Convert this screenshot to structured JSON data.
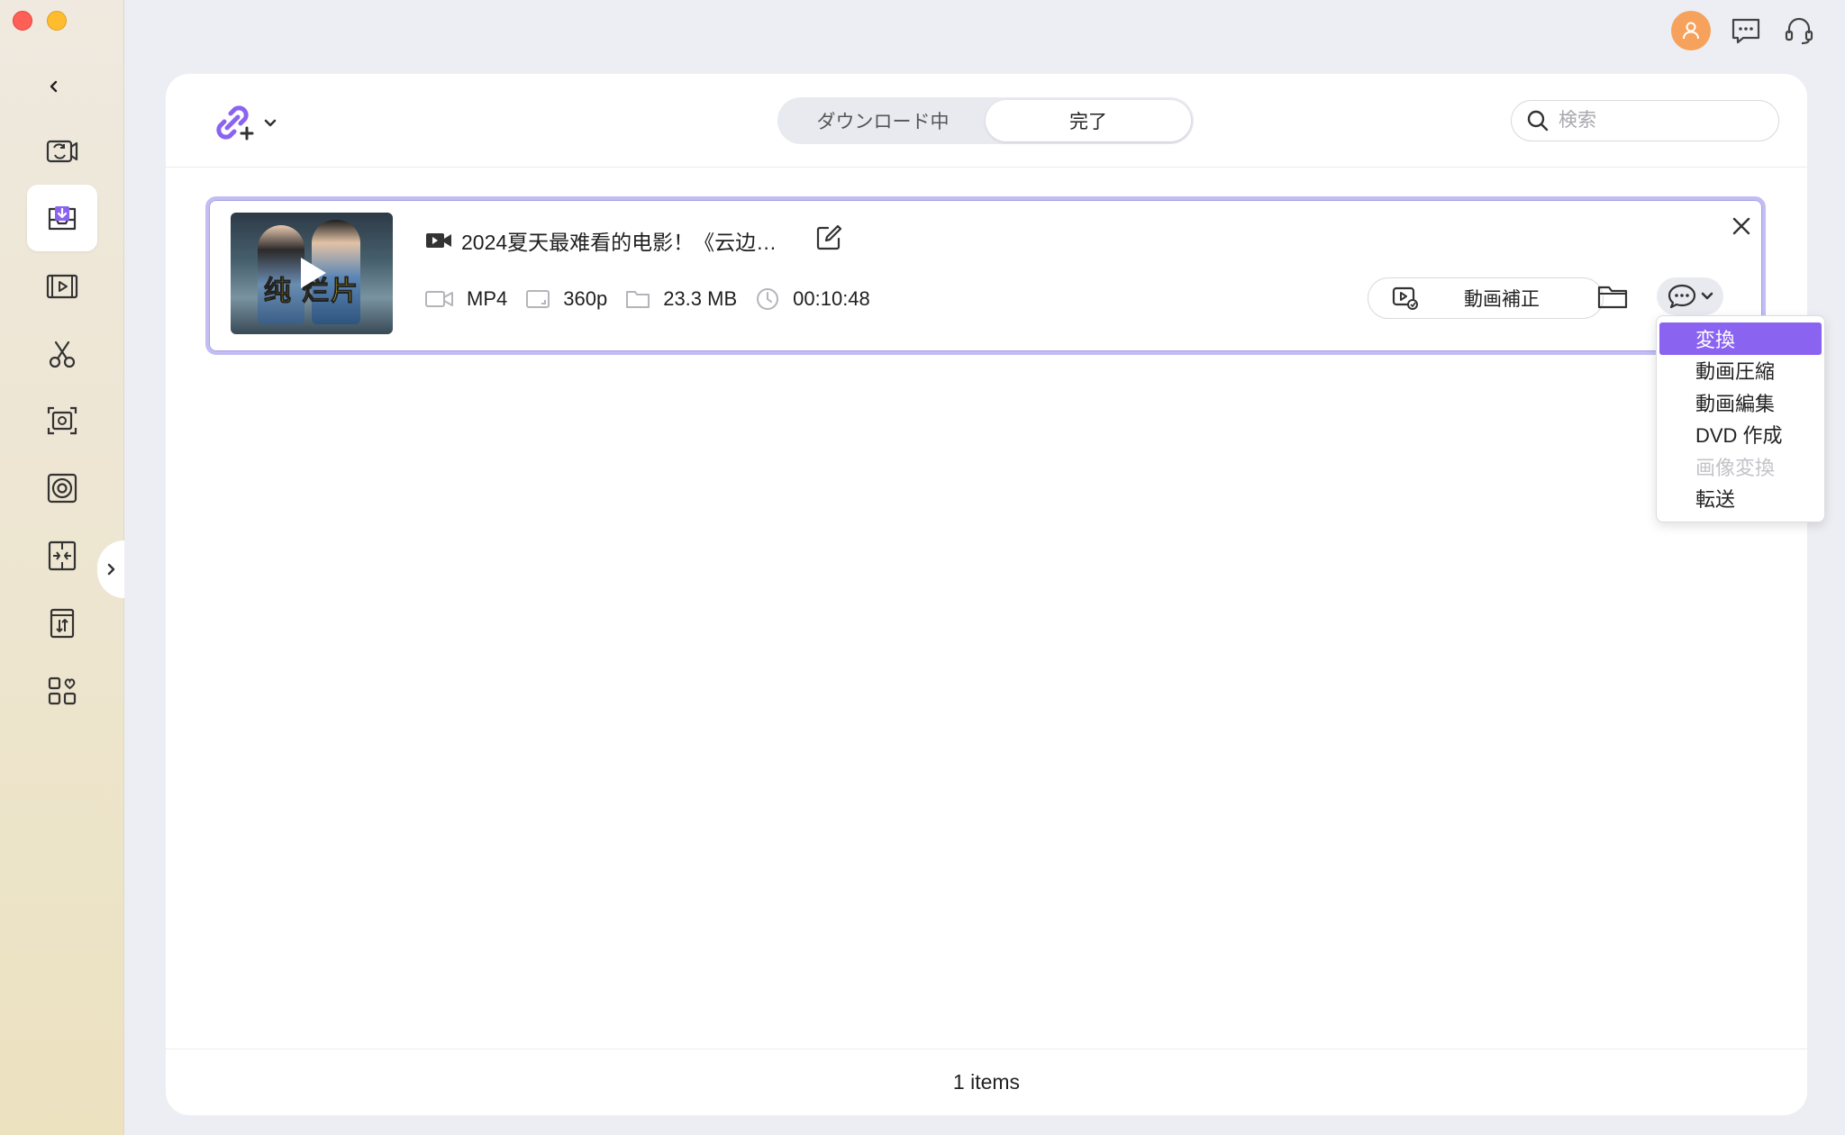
{
  "sidebar": {
    "items": [
      {
        "name": "convert-icon"
      },
      {
        "name": "download-icon",
        "active": true
      },
      {
        "name": "player-icon"
      },
      {
        "name": "cut-icon"
      },
      {
        "name": "screen-record-icon"
      },
      {
        "name": "audio-icon"
      },
      {
        "name": "compress-icon"
      },
      {
        "name": "merge-icon"
      },
      {
        "name": "toolbox-icon"
      }
    ]
  },
  "header": {
    "tabs": [
      {
        "label": "ダウンロード中",
        "selected": false
      },
      {
        "label": "完了",
        "selected": true
      }
    ],
    "search_placeholder": "検索"
  },
  "item": {
    "title": "2024夏天最难看的电影！《云边…",
    "thumbnail_caption": "纯 烂片",
    "format": "MP4",
    "resolution": "360p",
    "size": "23.3 MB",
    "duration": "00:10:48",
    "repair_label": "動画補正"
  },
  "menu": {
    "items": [
      {
        "label": "変換",
        "state": "active"
      },
      {
        "label": "動画圧縮",
        "state": "normal"
      },
      {
        "label": "動画編集",
        "state": "normal"
      },
      {
        "label": "DVD 作成",
        "state": "normal"
      },
      {
        "label": "画像変換",
        "state": "disabled"
      },
      {
        "label": "転送",
        "state": "normal"
      }
    ]
  },
  "footer": {
    "count_text": "1 items"
  },
  "colors": {
    "accent": "#8b63f1",
    "card_border": "#c2bdf2",
    "avatar": "#f6a25c"
  }
}
